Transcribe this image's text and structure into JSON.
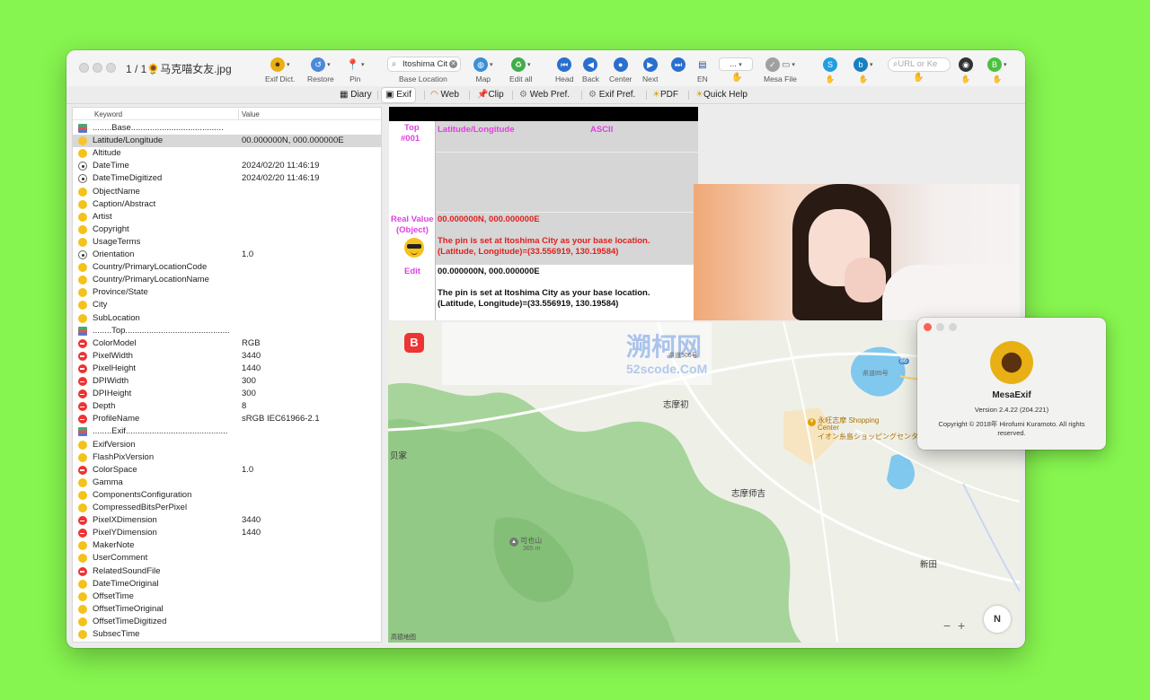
{
  "window": {
    "title": "1 / 1🌻马克喵女友.jpg"
  },
  "toolbar": {
    "exif_dict": "Exif Dict.",
    "restore": "Restore",
    "pin": "Pin",
    "search_value": "Itoshima Cit",
    "base_location": "Base Location",
    "map": "Map",
    "edit_all": "Edit all",
    "head": "Head",
    "back": "Back",
    "center": "Center",
    "next": "Next",
    "lang": "EN",
    "dots": "...",
    "mesa_file": "Mesa File",
    "url_placeholder": "URL or Ke"
  },
  "tabs": [
    "Diary",
    "Exif",
    "Web",
    "Clip",
    "Web Pref.",
    "Exif Pref.",
    "PDF",
    "Quick Help"
  ],
  "table": {
    "headers": {
      "keyword": "Keyword",
      "value": "Value"
    },
    "rows": [
      {
        "icon": "book",
        "keyword": "........Base.......................................",
        "value": ""
      },
      {
        "icon": "smile",
        "keyword": "Latitude/Longitude",
        "value": "00.000000N, 000.000000E"
      },
      {
        "icon": "cool",
        "keyword": "Altitude",
        "value": ""
      },
      {
        "icon": "ball",
        "keyword": "DateTime",
        "value": "2024/02/20 11:46:19"
      },
      {
        "icon": "ball",
        "keyword": "DateTimeDigitized",
        "value": "2024/02/20 11:46:19"
      },
      {
        "icon": "cool",
        "keyword": "ObjectName",
        "value": ""
      },
      {
        "icon": "cool",
        "keyword": "Caption/Abstract",
        "value": ""
      },
      {
        "icon": "cool",
        "keyword": "Artist",
        "value": ""
      },
      {
        "icon": "cool",
        "keyword": "Copyright",
        "value": ""
      },
      {
        "icon": "cool",
        "keyword": "UsageTerms",
        "value": ""
      },
      {
        "icon": "ball",
        "keyword": "Orientation",
        "value": "1.0"
      },
      {
        "icon": "cool",
        "keyword": "Country/PrimaryLocationCode",
        "value": ""
      },
      {
        "icon": "cool",
        "keyword": "Country/PrimaryLocationName",
        "value": ""
      },
      {
        "icon": "cool",
        "keyword": "Province/State",
        "value": ""
      },
      {
        "icon": "cool",
        "keyword": "City",
        "value": ""
      },
      {
        "icon": "cool",
        "keyword": "SubLocation",
        "value": ""
      },
      {
        "icon": "book",
        "keyword": "........Top............................................",
        "value": ""
      },
      {
        "icon": "no",
        "keyword": "ColorModel",
        "value": "RGB"
      },
      {
        "icon": "no",
        "keyword": "PixelWidth",
        "value": "3440"
      },
      {
        "icon": "no",
        "keyword": "PixelHeight",
        "value": "1440"
      },
      {
        "icon": "no",
        "keyword": "DPIWidth",
        "value": "300"
      },
      {
        "icon": "no",
        "keyword": "DPIHeight",
        "value": "300"
      },
      {
        "icon": "no",
        "keyword": "Depth",
        "value": "8"
      },
      {
        "icon": "no",
        "keyword": "ProfileName",
        "value": "sRGB IEC61966-2.1"
      },
      {
        "icon": "book",
        "keyword": "........Exif...........................................",
        "value": ""
      },
      {
        "icon": "cool",
        "keyword": "ExifVersion",
        "value": ""
      },
      {
        "icon": "cool",
        "keyword": "FlashPixVersion",
        "value": ""
      },
      {
        "icon": "no",
        "keyword": "ColorSpace",
        "value": "1.0"
      },
      {
        "icon": "cool",
        "keyword": "Gamma",
        "value": ""
      },
      {
        "icon": "cool",
        "keyword": "ComponentsConfiguration",
        "value": ""
      },
      {
        "icon": "cool",
        "keyword": "CompressedBitsPerPixel",
        "value": ""
      },
      {
        "icon": "no",
        "keyword": "PixelXDimension",
        "value": "3440"
      },
      {
        "icon": "no",
        "keyword": "PixelYDimension",
        "value": "1440"
      },
      {
        "icon": "cool",
        "keyword": "MakerNote",
        "value": ""
      },
      {
        "icon": "cool",
        "keyword": "UserComment",
        "value": ""
      },
      {
        "icon": "no",
        "keyword": "RelatedSoundFile",
        "value": ""
      },
      {
        "icon": "cool",
        "keyword": "DateTimeOriginal",
        "value": ""
      },
      {
        "icon": "cool",
        "keyword": "OffsetTime",
        "value": ""
      },
      {
        "icon": "cool",
        "keyword": "OffsetTimeOriginal",
        "value": ""
      },
      {
        "icon": "cool",
        "keyword": "OffsetTimeDigitized",
        "value": ""
      },
      {
        "icon": "cool",
        "keyword": "SubsecTime",
        "value": ""
      }
    ]
  },
  "detail": {
    "top_label": "Top",
    "top_number": "#001",
    "field_name": "Latitude/Longitude",
    "field_type": "ASCII",
    "real_value_label": "Real Value",
    "object_label": "(Object)",
    "real_value": "00.000000N, 000.000000E",
    "pin_note_1": "The pin is set at Itoshima City as your base location.",
    "pin_note_2": " (Latitude, Longitude)=(33.556919, 130.19584)",
    "edit_label": "Edit",
    "edit_value": "00.000000N, 000.000000E",
    "edit_note_1": "The pin is set at Itoshima City as your base location.",
    "edit_note_2": " (Latitude, Longitude)=(33.556919, 130.19584)"
  },
  "map": {
    "labels": {
      "shimachi": "志摩初",
      "shimashiki": "志摩师吉",
      "shinden": "新田",
      "kaike": "贝家",
      "mall_1": "永旺志摩 Shopping",
      "mall_2": "Center",
      "mall_3": "イオン糸島ショッピングセンター",
      "mountain": "可也山",
      "mountain_elev": "365 m",
      "road_1": "県道506号",
      "road_2": "県道85号",
      "route": "86",
      "attribution": "高德地图",
      "compass": "N",
      "zoom_out": "−",
      "zoom_in": "+"
    },
    "watermark": {
      "text": "溯柯网",
      "sub": "52scode.CoM"
    },
    "b_button": "B"
  },
  "about": {
    "name": "MesaExif",
    "version": "Version 2.4.22 (204.221)",
    "copyright": "Copyright © 2018年 Hirofumi Kuramoto. All rights reserved."
  },
  "colors": {
    "background": "#86f54f",
    "magenta": "#e040e0",
    "red": "#e02020",
    "map_water": "#80c8ee",
    "map_forest": "#a7d49a"
  }
}
